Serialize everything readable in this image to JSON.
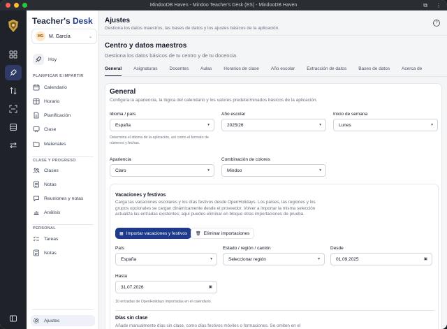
{
  "window": {
    "title": "MindooDB Haven - Mindoo Teacher's Desk (ES) - MindooDB Haven"
  },
  "sidebar": {
    "brand_a": "Teacher's",
    "brand_b": "Desk",
    "user_initials": "MG",
    "user_name": "M. García",
    "hoy": "Hoy",
    "section1": "PLANIFICAR E IMPARTIR",
    "items1": [
      "Calendario",
      "Horario",
      "Planificación",
      "Clase",
      "Materiales"
    ],
    "section2": "CLASE Y PROGRESO",
    "items2": [
      "Clases",
      "Notas",
      "Reuniones y notas",
      "Análisis"
    ],
    "section3": "PERSONAL",
    "items3": [
      "Tareas",
      "Notas"
    ],
    "settings": "Ajustes"
  },
  "page": {
    "title": "Ajustes",
    "subtitle": "Gestiona los datos maestros, las bases de datos y los ajustes básicos de la aplicación.",
    "section_title": "Centro y datos maestros",
    "section_subtitle": "Gestiona los datos básicos de tu centro y de tu docencia."
  },
  "tabs": [
    "General",
    "Asignaturas",
    "Docentes",
    "Aulas",
    "Horarios de clase",
    "Año escolar",
    "Extracción de datos",
    "Bases de datos",
    "Acerca de"
  ],
  "general": {
    "title": "General",
    "subtitle": "Configura la apariencia, la lógica del calendario y los valores predeterminados básicos de la aplicación.",
    "lang_label": "Idioma / país",
    "lang_value": "España",
    "lang_help": "Determina el idioma de la aplicación, así como el formato de números y fechas.",
    "year_label": "Año escolar",
    "year_value": "2025/26",
    "week_label": "Inicio de semana",
    "week_value": "Lunes",
    "appearance_label": "Apariencia",
    "appearance_value": "Claro",
    "colors_label": "Combinación de colores",
    "colors_value": "Mindoo"
  },
  "holidays": {
    "title": "Vacaciones y festivos",
    "desc": "Carga las vacaciones escolares y los días festivos desde OpenHolidays. Los países, las regiones y los grupos opcionales se cargan dinámicamente desde el proveedor. Volver a importar la misma selección actualiza las entradas existentes; aquí puedes eliminar en bloque otras importaciones de prueba.",
    "import_btn": "Importar vacaciones y festivos",
    "delete_btn": "Eliminar importaciones",
    "country_label": "País",
    "country_value": "España",
    "region_label": "Estado / región / cantón",
    "region_value": "Seleccionar región",
    "from_label": "Desde",
    "from_value": "01.09.2025",
    "to_label": "Hasta",
    "to_value": "31.07.2026",
    "count_text": "10 entradas de OpenHolidays importadas en el calendario.",
    "noclass_title": "Días sin clase",
    "noclass_desc": "Añade manualmente días sin clase, como días festivos móviles o formaciones. Se omiten en el"
  }
}
